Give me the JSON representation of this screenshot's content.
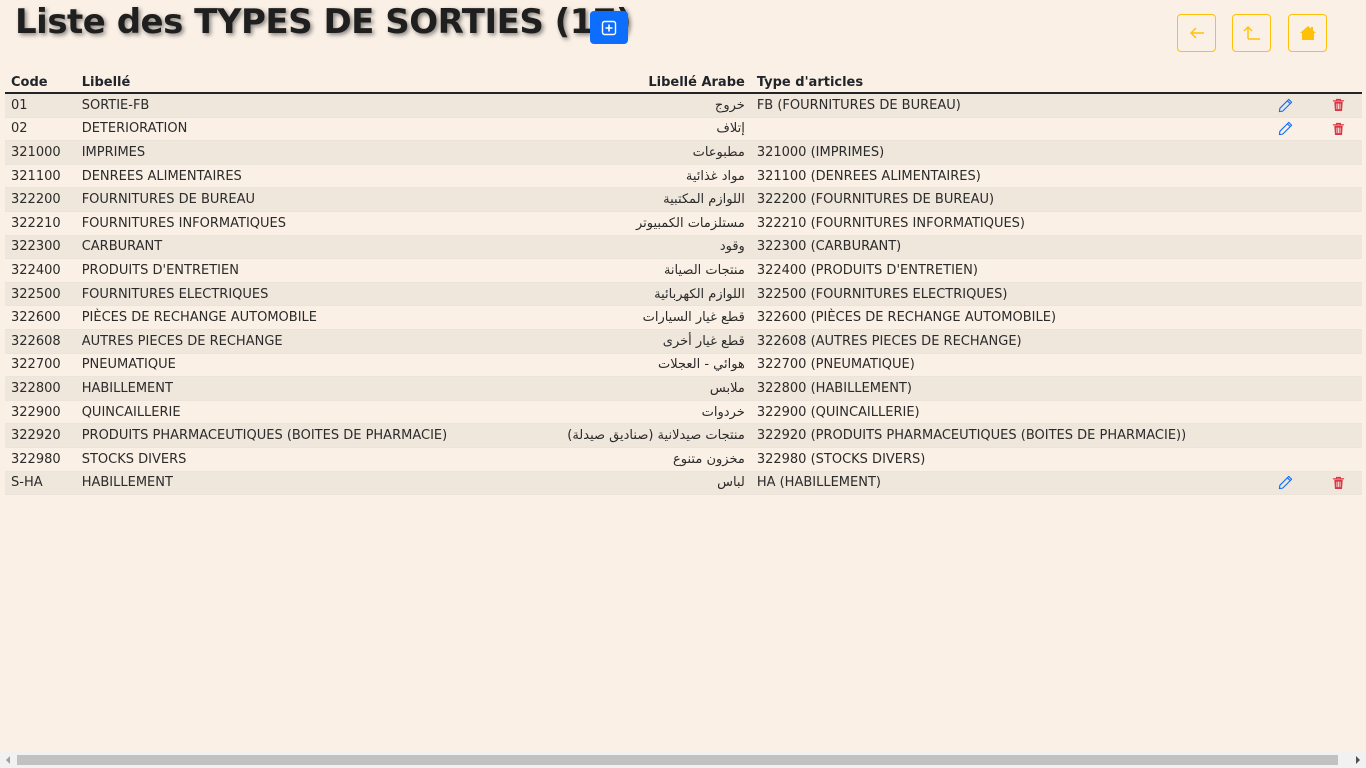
{
  "header": {
    "title": "Liste des TYPES DE SORTIES (17)"
  },
  "toolbar": {
    "add_icon": "plus-square-icon",
    "back_icon": "arrow-left-icon",
    "up_icon": "arrow-up-corner-icon",
    "home_icon": "house-icon",
    "accent_primary": "#0d6efd",
    "accent_warning": "#ffc107",
    "delete_color": "#dc3545"
  },
  "table": {
    "columns": {
      "code": "Code",
      "libelle": "Libellé",
      "libelle_arabe": "Libellé Arabe",
      "type_articles": "Type d'articles"
    },
    "rows": [
      {
        "code": "01",
        "libelle": "SORTIE-FB",
        "libelle_arabe": "خروج",
        "type": "FB (FOURNITURES DE BUREAU)",
        "actions": true
      },
      {
        "code": "02",
        "libelle": "DETERIORATION",
        "libelle_arabe": "إتلاف",
        "type": "",
        "actions": true
      },
      {
        "code": "321000",
        "libelle": "IMPRIMES",
        "libelle_arabe": "مطبوعات",
        "type": "321000 (IMPRIMES)",
        "actions": false
      },
      {
        "code": "321100",
        "libelle": "DENREES ALIMENTAIRES",
        "libelle_arabe": "مواد غذائية",
        "type": "321100 (DENREES ALIMENTAIRES)",
        "actions": false
      },
      {
        "code": "322200",
        "libelle": "FOURNITURES DE BUREAU",
        "libelle_arabe": "اللوازم المكتبية",
        "type": "322200 (FOURNITURES DE BUREAU)",
        "actions": false
      },
      {
        "code": "322210",
        "libelle": "FOURNITURES INFORMATIQUES",
        "libelle_arabe": "مستلزمات الكمبيوتر",
        "type": "322210 (FOURNITURES INFORMATIQUES)",
        "actions": false
      },
      {
        "code": "322300",
        "libelle": "CARBURANT",
        "libelle_arabe": "وقود",
        "type": "322300 (CARBURANT)",
        "actions": false
      },
      {
        "code": "322400",
        "libelle": "PRODUITS D'ENTRETIEN",
        "libelle_arabe": "منتجات الصيانة",
        "type": "322400 (PRODUITS D'ENTRETIEN)",
        "actions": false
      },
      {
        "code": "322500",
        "libelle": "FOURNITURES ELECTRIQUES",
        "libelle_arabe": "اللوازم الكهربائية",
        "type": "322500 (FOURNITURES ELECTRIQUES)",
        "actions": false
      },
      {
        "code": "322600",
        "libelle": "PIÈCES DE RECHANGE AUTOMOBILE",
        "libelle_arabe": "قطع غيار السيارات",
        "type": "322600 (PIÈCES DE RECHANGE AUTOMOBILE)",
        "actions": false
      },
      {
        "code": "322608",
        "libelle": "AUTRES PIECES DE RECHANGE",
        "libelle_arabe": "قطع غيار أخرى",
        "type": "322608 (AUTRES PIECES DE RECHANGE)",
        "actions": false
      },
      {
        "code": "322700",
        "libelle": "PNEUMATIQUE",
        "libelle_arabe": "هوائي - العجلات",
        "type": "322700 (PNEUMATIQUE)",
        "actions": false
      },
      {
        "code": "322800",
        "libelle": "HABILLEMENT",
        "libelle_arabe": "ملابس",
        "type": "322800 (HABILLEMENT)",
        "actions": false
      },
      {
        "code": "322900",
        "libelle": "QUINCAILLERIE",
        "libelle_arabe": "خردوات",
        "type": "322900 (QUINCAILLERIE)",
        "actions": false
      },
      {
        "code": "322920",
        "libelle": "PRODUITS PHARMACEUTIQUES (BOITES DE PHARMACIE)",
        "libelle_arabe": "منتجات صيدلانية (صناديق صيدلة)",
        "type": "322920 (PRODUITS PHARMACEUTIQUES (BOITES DE PHARMACIE))",
        "actions": false
      },
      {
        "code": "322980",
        "libelle": "STOCKS DIVERS",
        "libelle_arabe": "مخزون متنوع",
        "type": "322980 (STOCKS DIVERS)",
        "actions": false
      },
      {
        "code": "S-HA",
        "libelle": "HABILLEMENT",
        "libelle_arabe": "لباس",
        "type": "HA (HABILLEMENT)",
        "actions": true
      }
    ]
  }
}
